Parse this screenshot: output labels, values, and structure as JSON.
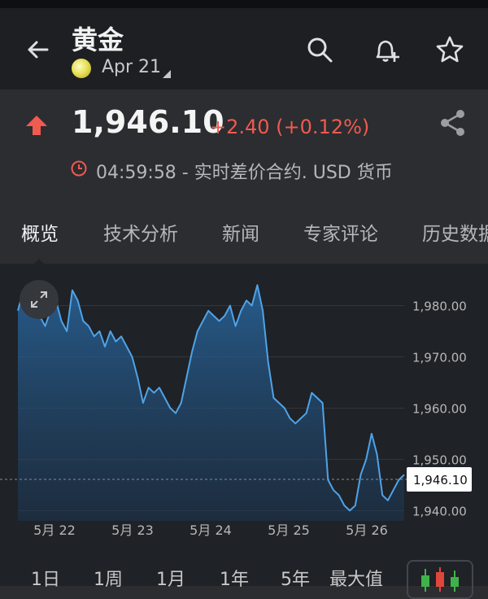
{
  "header": {
    "title": "黄金",
    "expiry": "Apr 21"
  },
  "quote": {
    "price": "1,946.10",
    "change": "+2.40 (+0.12%)",
    "time_text": "04:59:58 - 实时差价合约. USD 货币"
  },
  "tabs": [
    "概览",
    "技术分析",
    "新闻",
    "专家评论",
    "历史数据"
  ],
  "ranges": [
    "1日",
    "1周",
    "1月",
    "1年",
    "5年",
    "最大值"
  ],
  "chart_data": {
    "type": "area",
    "x_tick_labels": [
      "5月 22",
      "5月 23",
      "5月 24",
      "5月 25",
      "5月 26"
    ],
    "y_tick_labels": [
      "1,980.00",
      "1,970.00",
      "1,960.00",
      "1,950.00",
      "1,940.00"
    ],
    "ylim": [
      1938,
      1985
    ],
    "current_value": 1946.1,
    "current_label": "1,946.10",
    "values": [
      1979,
      1983,
      1982,
      1980,
      1978,
      1976,
      1979,
      1981,
      1977,
      1975,
      1983,
      1981,
      1977,
      1976,
      1974,
      1975,
      1972,
      1975,
      1973,
      1974,
      1972,
      1970,
      1966,
      1961,
      1964,
      1963,
      1964,
      1962,
      1960,
      1959,
      1961,
      1966,
      1971,
      1975,
      1977,
      1979,
      1978,
      1977,
      1978,
      1980,
      1976,
      1979,
      1981,
      1980,
      1984,
      1979,
      1969,
      1962,
      1961,
      1960,
      1958,
      1957,
      1958,
      1959,
      1963,
      1962,
      1961,
      1946,
      1944,
      1943,
      1941,
      1940,
      1941,
      1947,
      1950,
      1955,
      1951,
      1943,
      1942,
      1944,
      1946,
      1947
    ]
  }
}
